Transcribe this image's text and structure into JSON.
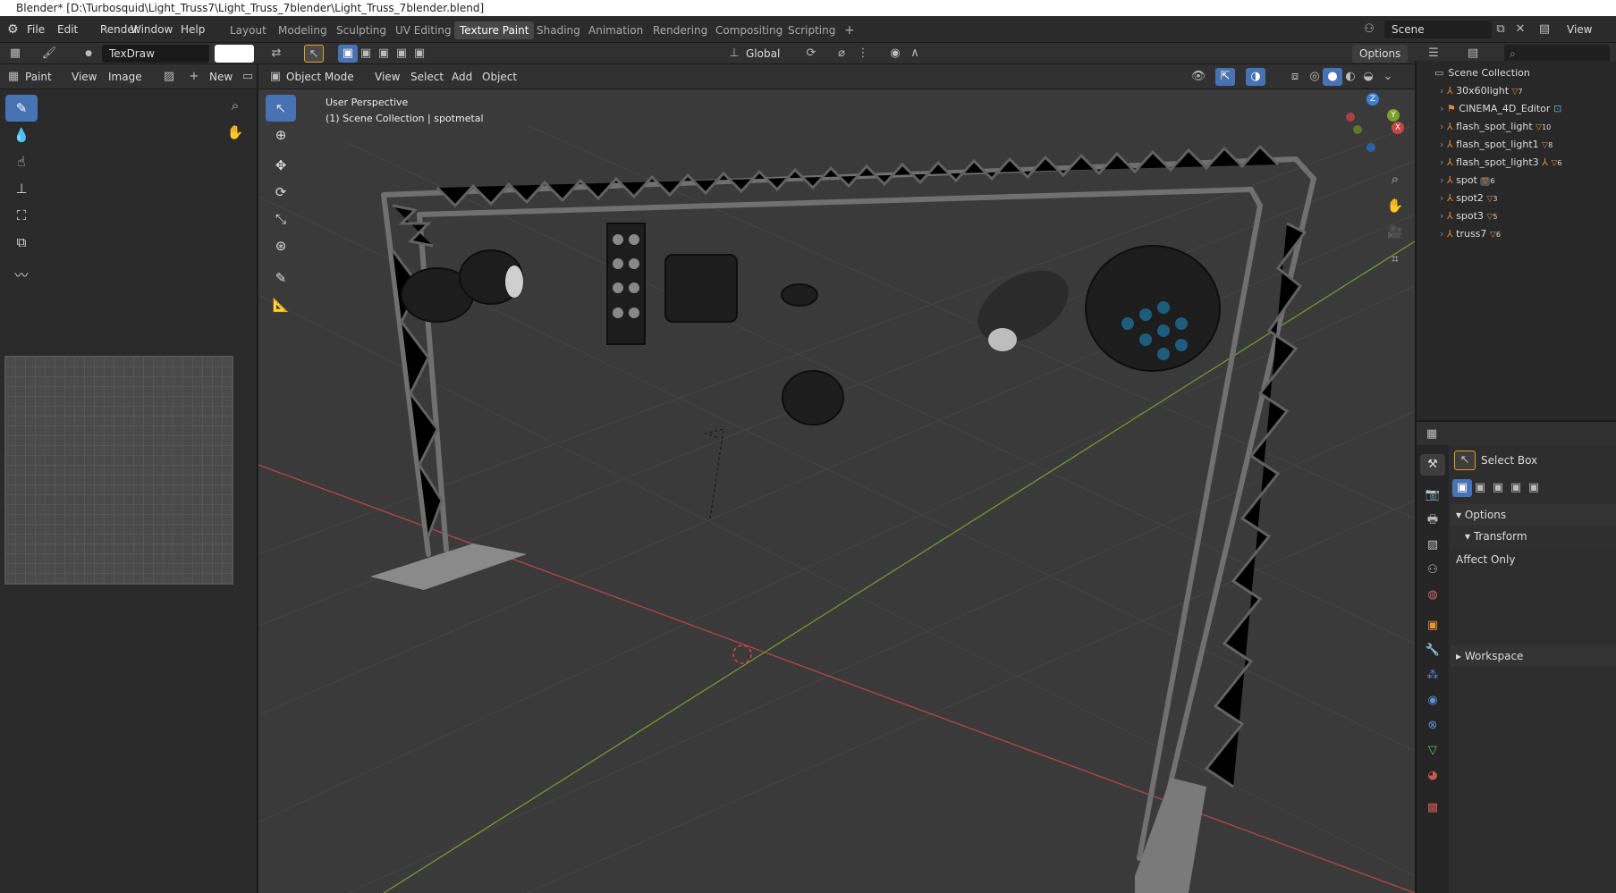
{
  "window_title": "Blender* [D:\\Turbosquid\\Light_Truss7\\Light_Truss_7blender\\Light_Truss_7blender.blend]",
  "menu": [
    "File",
    "Edit",
    "Render",
    "Window",
    "Help"
  ],
  "workspaces": [
    "Layout",
    "Modeling",
    "Sculpting",
    "UV Editing",
    "Texture Paint",
    "Shading",
    "Animation",
    "Rendering",
    "Compositing",
    "Scripting"
  ],
  "active_workspace": "Texture Paint",
  "add_workspace": "+",
  "scene_name": "Scene",
  "view_layer": "View Laye",
  "brush_name": "TexDraw",
  "paint_header": {
    "mode": "Paint",
    "view": "View",
    "image": "Image",
    "new": "New"
  },
  "viewport_header": {
    "mode": "Object Mode",
    "view": "View",
    "select": "Select",
    "add": "Add",
    "object": "Object",
    "orientation": "Global",
    "options": "Options"
  },
  "viewport_overlay": {
    "line1": "User Perspective",
    "line2": "(1) Scene Collection | spotmetal"
  },
  "gizmo": {
    "x": "X",
    "y": "Y",
    "z": "Z"
  },
  "outliner": {
    "root": "Scene Collection",
    "items": [
      {
        "name": "30x60light",
        "badge": "7"
      },
      {
        "name": "CINEMA_4D_Editor",
        "badge": ""
      },
      {
        "name": "flash_spot_light",
        "badge": "10"
      },
      {
        "name": "flash_spot_light1",
        "badge": "8"
      },
      {
        "name": "flash_spot_light3",
        "badge": "6"
      },
      {
        "name": "spot",
        "badge": "6"
      },
      {
        "name": "spot2",
        "badge": "3"
      },
      {
        "name": "spot3",
        "badge": "5"
      },
      {
        "name": "truss7",
        "badge": "6"
      }
    ]
  },
  "properties": {
    "tool_name": "Select Box",
    "options": "Options",
    "transform": "Transform",
    "affect_only": "Affect Only",
    "workspace": "Workspace"
  },
  "colors": {
    "accent": "#4772b3",
    "x_axis": "#c84545",
    "y_axis": "#7aa02e",
    "z_axis": "#3f7fd6",
    "badge": "#e08a3a"
  }
}
